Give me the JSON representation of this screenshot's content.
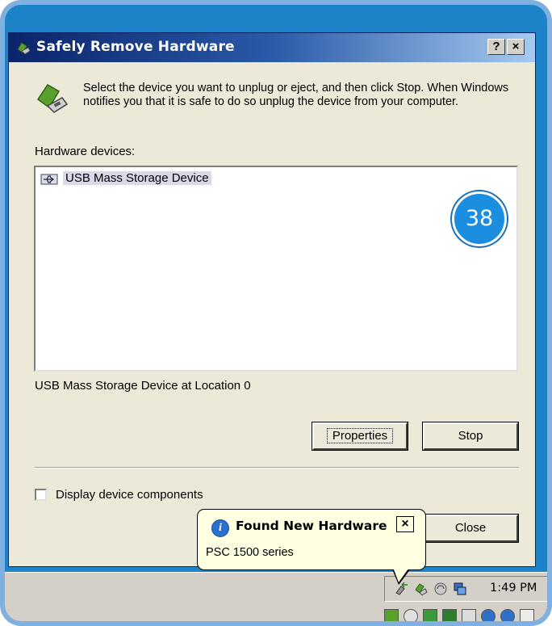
{
  "window": {
    "title": "Safely Remove Hardware",
    "help_label": "?",
    "close_label": "×"
  },
  "description": "Select the device you want to unplug or eject, and then click Stop. When Windows notifies you that it is safe to do so unplug the device from your computer.",
  "hardware_label": "Hardware devices:",
  "devices": [
    {
      "label": "USB Mass Storage Device",
      "icon": "usb-device-icon"
    }
  ],
  "step_badge": "38",
  "device_location": "USB Mass Storage Device at Location 0",
  "buttons": {
    "properties": "Properties",
    "stop": "Stop",
    "close": "Close"
  },
  "checkbox": {
    "label": "Display device components",
    "checked": false
  },
  "balloon": {
    "title": "Found New Hardware",
    "text": "PSC 1500 series",
    "icon": "info-icon",
    "close_label": "×"
  },
  "taskbar": {
    "clock": "1:49 PM",
    "tray_icons": [
      "usb-remove-icon",
      "hardware-icon",
      "speaker-muted-icon",
      "network-icon"
    ],
    "quick_icons": [
      "window-icon",
      "search-icon",
      "monitor-icon",
      "chip-icon",
      "volume-icon",
      "arrow-circle-icon",
      "arrow-circle-icon",
      "cursor-icon"
    ]
  },
  "colors": {
    "title_gradient_start": "#0a246a",
    "title_gradient_end": "#a6caf0",
    "dialog_bg": "#ece9d8",
    "balloon_bg": "#ffffe1",
    "badge": "#1c8ee0",
    "frame": "#1d83c9"
  }
}
